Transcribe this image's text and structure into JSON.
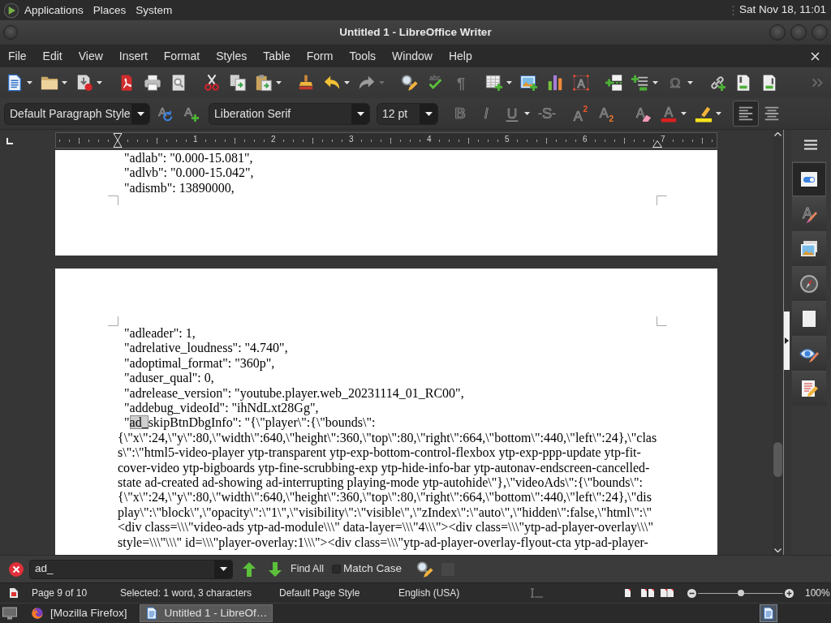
{
  "top_panel": {
    "menus": [
      "Applications",
      "Places",
      "System"
    ],
    "clock": "Sat Nov 18, 11:01"
  },
  "window": {
    "title": "Untitled 1 - LibreOffice Writer"
  },
  "menu_bar": [
    "File",
    "Edit",
    "View",
    "Insert",
    "Format",
    "Styles",
    "Table",
    "Form",
    "Tools",
    "Window",
    "Help"
  ],
  "standard_toolbar": [
    {
      "kind": "new",
      "dropdown": true,
      "disabled": false
    },
    {
      "kind": "open",
      "dropdown": true,
      "disabled": false
    },
    {
      "kind": "save",
      "dropdown": true,
      "disabled": false
    },
    {
      "kind": "pdf",
      "dropdown": false,
      "disabled": false
    },
    {
      "kind": "print",
      "dropdown": false,
      "disabled": false
    },
    {
      "kind": "preview",
      "dropdown": false,
      "disabled": false
    },
    {
      "kind": "cut",
      "dropdown": false,
      "disabled": false
    },
    {
      "kind": "copy",
      "dropdown": false,
      "disabled": false
    },
    {
      "kind": "paste",
      "dropdown": true,
      "disabled": false
    },
    {
      "kind": "clone",
      "dropdown": false,
      "disabled": false
    },
    {
      "kind": "undo",
      "dropdown": true,
      "disabled": false
    },
    {
      "kind": "redo",
      "dropdown": true,
      "disabled": true
    },
    {
      "kind": "find",
      "dropdown": false,
      "disabled": false
    },
    {
      "kind": "spelling",
      "glyph": "abc",
      "dropdown": false,
      "disabled": false
    },
    {
      "kind": "marks",
      "glyph": "¶",
      "dropdown": false,
      "disabled": false
    },
    {
      "kind": "table",
      "dropdown": true,
      "disabled": false
    },
    {
      "kind": "image",
      "dropdown": false,
      "disabled": false
    },
    {
      "kind": "chart",
      "dropdown": false,
      "disabled": false
    },
    {
      "kind": "textbox",
      "glyph": "A",
      "dropdown": false,
      "disabled": false
    },
    {
      "kind": "pagebreak",
      "dropdown": false,
      "disabled": false
    },
    {
      "kind": "field",
      "dropdown": true,
      "disabled": false
    },
    {
      "kind": "special",
      "glyph": "Ω",
      "dropdown": true,
      "disabled": false
    },
    {
      "kind": "hyperlink",
      "dropdown": false,
      "disabled": false
    },
    {
      "kind": "footnote",
      "dropdown": false,
      "disabled": false
    },
    {
      "kind": "comment",
      "dropdown": false,
      "disabled": false
    },
    {
      "kind": "more",
      "dropdown": false,
      "disabled": false
    }
  ],
  "formatting_toolbar": {
    "paragraph_style": "Default Paragraph Style",
    "style_buttons": [
      {
        "kind": "updatestyle",
        "glyph": "A"
      },
      {
        "kind": "newstyle",
        "glyph": "A"
      }
    ],
    "font_name": "Liberation Serif",
    "font_size": "12 pt",
    "buttons": [
      {
        "kind": "bold",
        "glyph": "B",
        "dropdown": false,
        "selected": false
      },
      {
        "kind": "italic",
        "glyph": "I",
        "dropdown": false,
        "selected": false
      },
      {
        "kind": "underline",
        "glyph": "U",
        "dropdown": true,
        "selected": false
      },
      {
        "kind": "strike",
        "glyph": "S",
        "dropdown": false,
        "selected": false
      },
      {
        "kind": "superscript",
        "glyph": "A",
        "index": "2",
        "dropdown": false,
        "selected": false
      },
      {
        "kind": "subscript",
        "glyph": "A",
        "index": "2",
        "dropdown": false,
        "selected": false
      },
      {
        "kind": "clear",
        "glyph": "A",
        "dropdown": false,
        "selected": false
      },
      {
        "kind": "fontcolor",
        "glyph": "A",
        "dropdown": true,
        "selected": false
      },
      {
        "kind": "highlight",
        "dropdown": true,
        "selected": false
      },
      {
        "kind": "alignleft",
        "dropdown": false,
        "selected": true
      },
      {
        "kind": "aligncenter",
        "dropdown": false,
        "selected": false
      }
    ]
  },
  "ruler": {
    "labels": [
      "1",
      "2",
      "3",
      "4",
      "5",
      "6",
      "7"
    ]
  },
  "document": {
    "pages": [
      {
        "paragraphs": [
          {
            "text": "\"adlab\": \"0.000-15.081\","
          },
          {
            "text": "\"adlvb\": \"0.000-15.042\","
          },
          {
            "text": "\"adismb\": 13890000,"
          }
        ]
      },
      {
        "paragraphs": [
          {
            "text": "\"adleader\": 1,"
          },
          {
            "text": "\"adrelative_loudness\": \"4.740\","
          },
          {
            "text": "\"adoptimal_format\": \"360p\","
          },
          {
            "text": "\"aduser_qual\": 0,"
          },
          {
            "text": "\"adrelease_version\": \"youtube.player.web_20231114_01_RC00\","
          },
          {
            "text": "\"addebug_videoId\": \"ihNdLxt28Gg\","
          },
          {
            "lead": "\"",
            "selection": "ad_",
            "lines": [
              "skipBtnDbgInfo\": \"{\\\"player\\\":{\\\"bounds\\\":",
              "{\\\"x\\\":24,\\\"y\\\":80,\\\"width\\\":640,\\\"height\\\":360,\\\"top\\\":80,\\\"right\\\":664,\\\"bottom\\\":440,\\\"left\\\":24},\\\"clas",
              "s\\\":\\\"html5-video-player ytp-transparent ytp-exp-bottom-control-flexbox ytp-exp-ppp-update ytp-fit-",
              "cover-video ytp-bigboards ytp-fine-scrubbing-exp ytp-hide-info-bar ytp-autonav-endscreen-cancelled-",
              "state ad-created ad-showing ad-interrupting playing-mode ytp-autohide\\\"},\\\"videoAds\\\":{\\\"bounds\\\":",
              "{\\\"x\\\":24,\\\"y\\\":80,\\\"width\\\":640,\\\"height\\\":360,\\\"top\\\":80,\\\"right\\\":664,\\\"bottom\\\":440,\\\"left\\\":24},\\\"dis",
              "play\\\":\\\"block\\\",\\\"opacity\\\":\\\"1\\\",\\\"visibility\\\":\\\"visible\\\",\\\"zIndex\\\":\\\"auto\\\",\\\"hidden\\\":false,\\\"html\\\":\\\"",
              "<div class=\\\\\\\"video-ads ytp-ad-module\\\\\\\" data-layer=\\\\\\\"4\\\\\\\"><div class=\\\\\\\"ytp-ad-player-overlay\\\\\\\"",
              "style=\\\\\\\"\\\\\\\" id=\\\\\\\"player-overlay:1\\\\\\\"><div class=\\\\\\\"ytp-ad-player-overlay-flyout-cta ytp-ad-player-"
            ]
          }
        ]
      }
    ]
  },
  "sidebar": {
    "tabs": [
      {
        "kind": "properties",
        "selected": true
      },
      {
        "kind": "styles",
        "glyph": "A",
        "selected": false
      },
      {
        "kind": "gallery",
        "selected": false
      },
      {
        "kind": "navigator",
        "selected": false
      },
      {
        "kind": "page",
        "selected": false
      },
      {
        "kind": "inspector",
        "selected": false
      },
      {
        "kind": "changes",
        "selected": false
      }
    ]
  },
  "find_toolbar": {
    "search": {
      "value": "ad_"
    },
    "find_all": "Find All",
    "match_case": {
      "label": "Match Case",
      "checked": false
    }
  },
  "status_bar": {
    "page": "Page 9 of 10",
    "selection": "Selected: 1 word, 3 characters",
    "page_style": "Default Page Style",
    "language": "English (USA)",
    "zoom_slider": {
      "level": 0.5
    },
    "zoom": "100%"
  },
  "taskbar": {
    "tasks": [
      {
        "kind": "browser",
        "label": "[Mozilla Firefox]",
        "selected": false
      },
      {
        "kind": "writer",
        "label": "Untitled 1 - LibreOf…",
        "selected": true
      }
    ]
  }
}
